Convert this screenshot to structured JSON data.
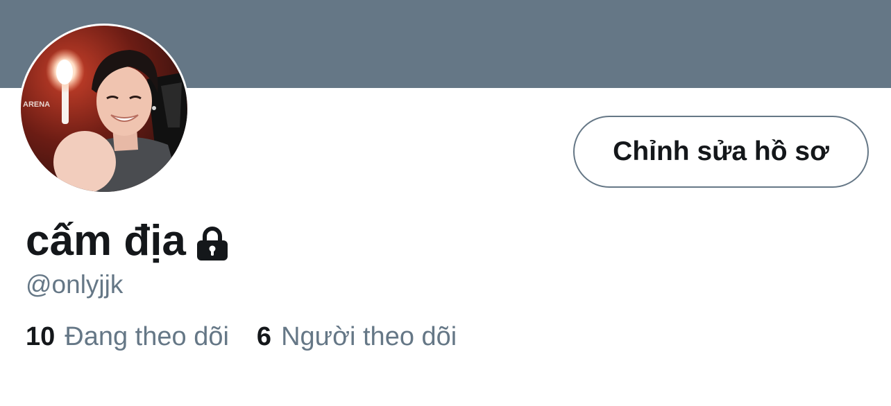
{
  "profile": {
    "display_name": "cấm địa",
    "handle": "@onlyjjk",
    "protected_icon": "lock-icon",
    "avatar_icon": "profile-photo"
  },
  "actions": {
    "edit_profile_label": "Chỉnh sửa hồ sơ"
  },
  "stats": {
    "following_count": "10",
    "following_label": "Đang theo dõi",
    "followers_count": "6",
    "followers_label": "Người theo dõi"
  },
  "colors": {
    "banner": "#657786",
    "text_primary": "#14171a",
    "text_secondary": "#657786",
    "background": "#ffffff"
  }
}
